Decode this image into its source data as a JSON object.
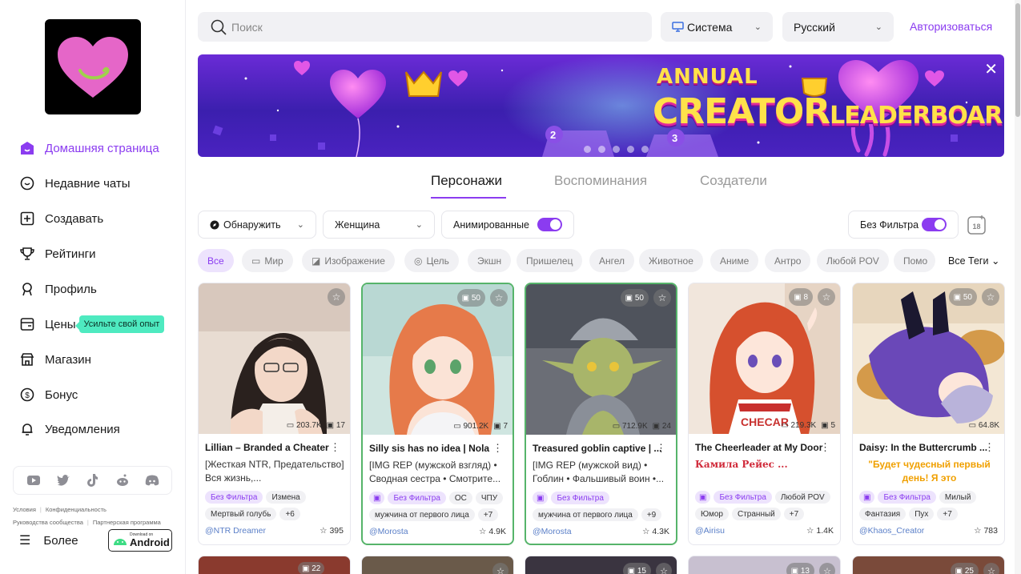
{
  "sidebar": {
    "nav": [
      {
        "label": "Домашняя страница",
        "icon": "home-icon"
      },
      {
        "label": "Недавние чаты",
        "icon": "chat-icon"
      },
      {
        "label": "Создавать",
        "icon": "plus-square-icon"
      },
      {
        "label": "Рейтинги",
        "icon": "trophy-icon"
      },
      {
        "label": "Профиль",
        "icon": "user-icon"
      },
      {
        "label": "Цены",
        "icon": "pricing-icon"
      },
      {
        "label": "Магазин",
        "icon": "store-icon"
      },
      {
        "label": "Бонус",
        "icon": "coin-icon"
      },
      {
        "label": "Уведомления",
        "icon": "bell-icon"
      }
    ],
    "promo": "Усильте свой опыт",
    "legal1": [
      "Условия",
      "Конфиденциальность"
    ],
    "legal2": [
      "Руководства сообщества",
      "Партнерская программа"
    ],
    "more": "Более",
    "android_small": "Download on",
    "android_big": "Android"
  },
  "topbar": {
    "search_placeholder": "Поиск",
    "theme": "Система",
    "language": "Русский",
    "login": "Авторизоваться"
  },
  "banner": {
    "line1": "ANNUAL",
    "line2a": "CREATOR",
    "line2b": "LEADERBOARD",
    "badge2": "2",
    "badge3": "3"
  },
  "tabs": [
    "Персонажи",
    "Воспоминания",
    "Создатели"
  ],
  "filters": {
    "discover": "Обнаружить",
    "gender": "Женщина",
    "animated": "Анимированные",
    "nofilter": "Без Фильтра"
  },
  "chips": [
    {
      "label": "Все",
      "icon": ""
    },
    {
      "label": "Мир",
      "icon": "▭"
    },
    {
      "label": "Изображение",
      "icon": "◪"
    },
    {
      "label": "Цель",
      "icon": "◎"
    },
    {
      "label": "Экшн",
      "icon": ""
    },
    {
      "label": "Пришелец",
      "icon": ""
    },
    {
      "label": "Ангел",
      "icon": ""
    },
    {
      "label": "Животное",
      "icon": ""
    },
    {
      "label": "Аниме",
      "icon": ""
    },
    {
      "label": "Антро",
      "icon": ""
    },
    {
      "label": "Любой POV",
      "icon": ""
    },
    {
      "label": "Помо",
      "icon": ""
    }
  ],
  "all_tags": "Все Теги",
  "cards": [
    {
      "name": "Lillian – Branded a Cheater",
      "desc": "[Жесткая NTR, Предательство] Вся жизнь,...",
      "img_count": "",
      "chats": "203.7K",
      "memories": "17",
      "tags": [
        "Без Фильтра",
        "Измена",
        "Мертвый голубь",
        "+6"
      ],
      "author": "@NTR Dreamer",
      "likes": "395"
    },
    {
      "name": "Silly sis has no idea | Nola",
      "desc": "[IMG REP (мужской взгляд) • Сводная сестра • Смотрите...",
      "img_count": "50",
      "chats": "901.2K",
      "memories": "7",
      "tags": [
        "▣",
        "Без Фильтра",
        "OC",
        "ЧПУ",
        "мужчина от первого лица",
        "+7"
      ],
      "author": "@Morosta",
      "likes": "4.9K"
    },
    {
      "name": "Treasured goblin captive | ...",
      "desc": "[IMG REP (мужской вид) • Гоблин • Фальшивый воин •...",
      "img_count": "50",
      "chats": "712.9K",
      "memories": "24",
      "tags": [
        "▣",
        "Без Фильтра",
        "мужчина от первого лица",
        "+9"
      ],
      "author": "@Morosta",
      "likes": "4.3K"
    },
    {
      "name": "The Cheerleader at My Door",
      "desc": "Камила Рейес ...",
      "img_count": "8",
      "chats": "219.3K",
      "memories": "5",
      "tags": [
        "▣",
        "Без Фильтра",
        "Любой POV",
        "Юмор",
        "Странный",
        "+7"
      ],
      "author": "@Airisu",
      "likes": "1.4K"
    },
    {
      "name": "Daisy: In the Buttercrumb ...",
      "desc": "\"Будет чудесный первый день! Я это",
      "img_count": "50",
      "chats": "64.8K",
      "memories": "",
      "tags": [
        "▣",
        "Без Фильтра",
        "Милый",
        "Фантазия",
        "Пух",
        "+7"
      ],
      "author": "@Khaos_Creator",
      "likes": "783"
    }
  ],
  "next_row_badges": [
    "",
    "22",
    "",
    "15",
    "13",
    "25"
  ],
  "colors": {
    "accent": "#8b3cf0",
    "promo": "#4eeac0",
    "author": "#5a7fc8"
  }
}
